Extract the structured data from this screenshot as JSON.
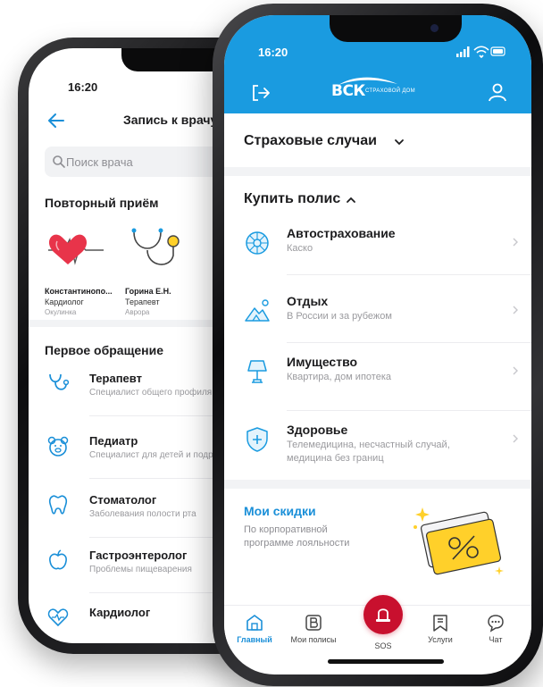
{
  "back_screen": {
    "time": "16:20",
    "title": "Запись к врачу",
    "search_placeholder": "Поиск врача",
    "repeat_section_title": "Повторный приём",
    "doctors": [
      {
        "name": "Константинопо...",
        "specialty": "Кардиолог",
        "clinic": "Окулинка"
      },
      {
        "name": "Горина Е.Н.",
        "specialty": "Терапевт",
        "clinic": "Аврора"
      }
    ],
    "first_section_title": "Первое обращение",
    "specialists": [
      {
        "title": "Терапевт",
        "subtitle": "Специалист общего профиля",
        "icon": "stethoscope-icon"
      },
      {
        "title": "Педиатр",
        "subtitle": "Специалист для детей и подростков",
        "icon": "teddy-bear-icon"
      },
      {
        "title": "Стоматолог",
        "subtitle": "Заболевания полости рта",
        "icon": "tooth-icon"
      },
      {
        "title": "Гастроэнтеролог",
        "subtitle": "Проблемы пищеварения",
        "icon": "apple-icon"
      },
      {
        "title": "Кардиолог",
        "subtitle": "",
        "icon": "heart-icon"
      }
    ]
  },
  "front_screen": {
    "time": "16:20",
    "brand": {
      "mark": "ВСК",
      "tagline": "СТРАХОВОЙ ДОМ"
    },
    "insurance_cases_label": "Страховые случаи",
    "buy_policy_label": "Купить полис",
    "policies": [
      {
        "title": "Автострахование",
        "subtitle": "Каско",
        "icon": "wheel-icon"
      },
      {
        "title": "Отдых",
        "subtitle": "В России и за рубежом",
        "icon": "mountain-icon"
      },
      {
        "title": "Имущество",
        "subtitle": "Квартира, дом ипотека",
        "icon": "lamp-icon"
      },
      {
        "title": "Здоровье",
        "subtitle": "Телемедицина, несчастный случай, медицина без границ",
        "icon": "shield-plus-icon"
      }
    ],
    "discounts": {
      "title": "Мои скидки",
      "subtitle": "По корпоративной программе лояльности"
    },
    "tabs": [
      {
        "label": "Главный",
        "icon": "home-icon",
        "active": true
      },
      {
        "label": "Мои полисы",
        "icon": "policy-b-icon",
        "active": false
      },
      {
        "label": "SOS",
        "icon": "siren-icon",
        "active": false
      },
      {
        "label": "Услуги",
        "icon": "services-icon",
        "active": false
      },
      {
        "label": "Чат",
        "icon": "chat-icon",
        "active": false
      }
    ]
  },
  "colors": {
    "brand_blue": "#1a9be0",
    "link_blue": "#1a8fd8",
    "sos_red": "#c8102e",
    "coupon_yellow": "#ffd02a"
  }
}
